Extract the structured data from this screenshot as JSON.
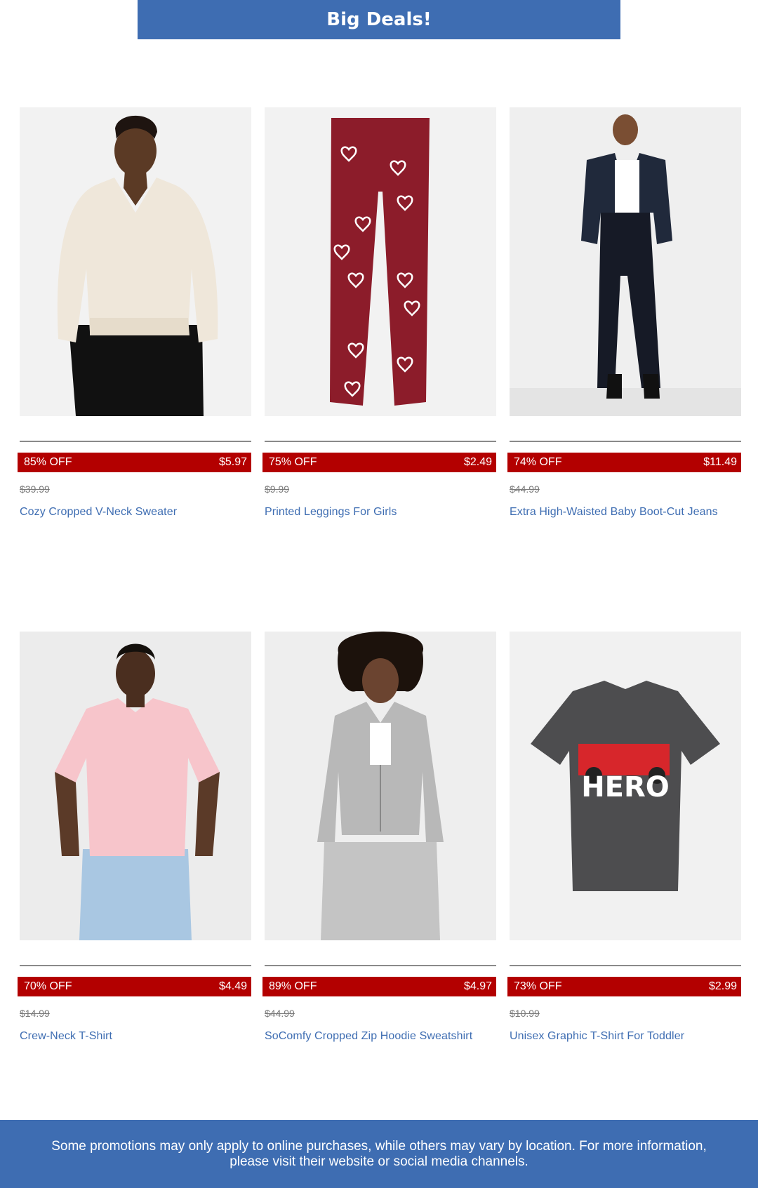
{
  "banner": {
    "title": "Big Deals!"
  },
  "products": [
    {
      "discount": "85% OFF",
      "price": "$5.97",
      "original_price": "$39.99",
      "name": "Cozy Cropped V-Neck Sweater"
    },
    {
      "discount": "75% OFF",
      "price": "$2.49",
      "original_price": "$9.99",
      "name": "Printed Leggings For Girls"
    },
    {
      "discount": "74% OFF",
      "price": "$11.49",
      "original_price": "$44.99",
      "name": "Extra High-Waisted Baby Boot-Cut Jeans"
    },
    {
      "discount": "70% OFF",
      "price": "$4.49",
      "original_price": "$14.99",
      "name": "Crew-Neck T-Shirt"
    },
    {
      "discount": "89% OFF",
      "price": "$4.97",
      "original_price": "$44.99",
      "name": "SoComfy Cropped Zip Hoodie Sweatshirt"
    },
    {
      "discount": "73% OFF",
      "price": "$2.99",
      "original_price": "$10.99",
      "name": "Unisex Graphic T-Shirt For Toddler",
      "graphic_text": "HERO"
    }
  ],
  "footer": {
    "line1": "Some promotions may only apply to online purchases, while others may vary by location. For more information,",
    "line2": "please visit their website or social media channels."
  },
  "colors": {
    "brand_blue": "#3e6db2",
    "deal_red": "#b30000",
    "image_bg": "#f1f1f1"
  }
}
